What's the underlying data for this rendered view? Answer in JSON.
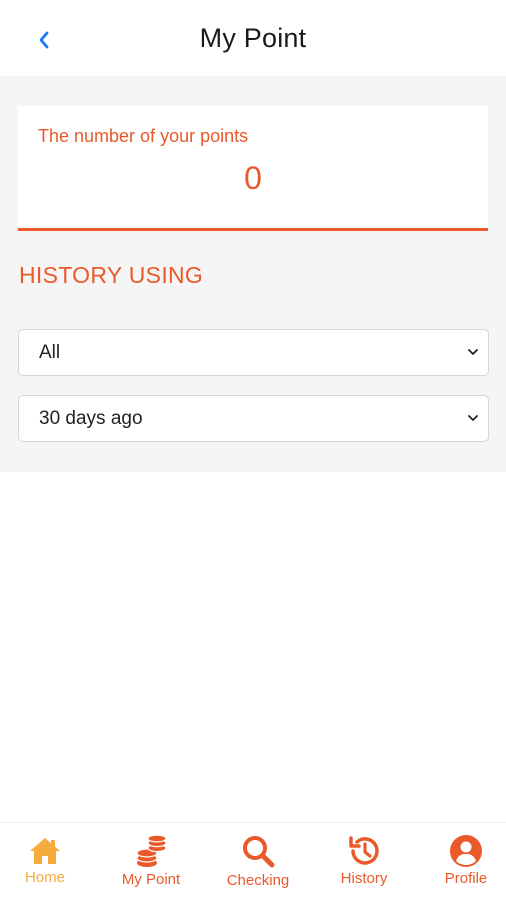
{
  "header": {
    "title": "My Point",
    "back_icon": "chevron-left-icon",
    "back_color": "#1877f2"
  },
  "points_card": {
    "label": "The number of your points",
    "value": "0"
  },
  "history": {
    "title": "HISTORY USING",
    "filters": {
      "type": {
        "selected": "All"
      },
      "period": {
        "selected": "30 days ago"
      }
    }
  },
  "tabbar": {
    "tabs": [
      {
        "label": "Home",
        "icon": "home-icon",
        "active": true
      },
      {
        "label": "My Point",
        "icon": "coins-icon",
        "active": false
      },
      {
        "label": "Checking",
        "icon": "search-icon",
        "active": false
      },
      {
        "label": "History",
        "icon": "history-icon",
        "active": false
      },
      {
        "label": "Profile",
        "icon": "user-circle-icon",
        "active": false
      }
    ]
  },
  "colors": {
    "accent": "#e9592a",
    "active_tab": "#f5ac3c",
    "background": "#f5f5f5"
  }
}
